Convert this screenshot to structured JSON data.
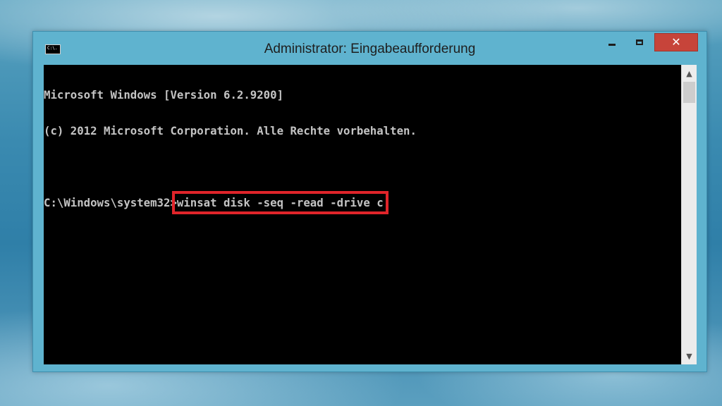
{
  "window": {
    "title": "Administrator: Eingabeaufforderung",
    "icon": "cmd-icon",
    "icon_label": "C:\\.",
    "controls": {
      "minimize": "minimize-icon",
      "maximize": "maximize-icon",
      "close_glyph": "✕"
    }
  },
  "console": {
    "line1": "Microsoft Windows [Version 6.2.9200]",
    "line2": "(c) 2012 Microsoft Corporation. Alle Rechte vorbehalten.",
    "line3": "",
    "prompt": "C:\\Windows\\system32>",
    "command": "winsat disk -seq -read -drive c"
  },
  "scrollbar": {
    "up_arrow": "▲",
    "down_arrow": "▼"
  },
  "colors": {
    "titlebar": "#5fb3cf",
    "close_button": "#c7443a",
    "console_background": "#000000",
    "console_text": "#c4c4c4",
    "highlight_box": "#e0242a"
  }
}
